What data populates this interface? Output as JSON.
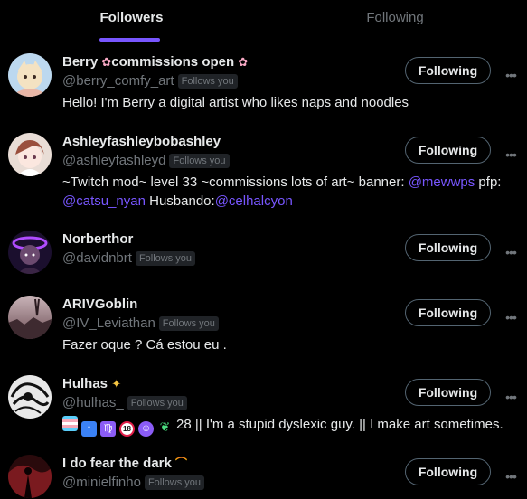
{
  "tabs": {
    "followers": "Followers",
    "following": "Following"
  },
  "users": [
    {
      "name": "Berry",
      "name_suffix": "commissions open",
      "handle": "@berry_comfy_art",
      "badge": "Follows you",
      "bio": "Hello! I'm Berry a digital artist who likes naps and noodles",
      "button": "Following"
    },
    {
      "name": "Ashleyfashleybobashley",
      "handle": "@ashleyfashleyd",
      "badge": "Follows you",
      "bio_part1": "~Twitch mod~ level 33 ~commissions lots of art~ banner: ",
      "mention1": "@mewwps",
      "bio_part2": " pfp:",
      "mention2": "@catsu_nyan",
      "bio_part3": " Husbando:",
      "mention3": "@celhalcyon",
      "button": "Following"
    },
    {
      "name": "Norberthor",
      "handle": "@davidnbrt",
      "badge": "Follows you",
      "button": "Following"
    },
    {
      "name": "ARIVGoblin",
      "handle": "@IV_Leviathan",
      "badge": "Follows you",
      "bio": "Fazer oque ? Cá estou eu .",
      "button": "Following"
    },
    {
      "name": "Hulhas",
      "handle": "@hulhas_",
      "badge": "Follows you",
      "bio": "28 || I'm a stupid dyslexic guy. || I make art sometimes.",
      "button": "Following"
    },
    {
      "name": "I do fear the dark",
      "handle": "@minielfinho",
      "badge": "Follows you",
      "button": "Following"
    }
  ],
  "more_glyph": "•••",
  "colors": {
    "accent": "#7856ff",
    "muted": "#71767b",
    "text": "#e7e9ea",
    "border": "#536471"
  }
}
